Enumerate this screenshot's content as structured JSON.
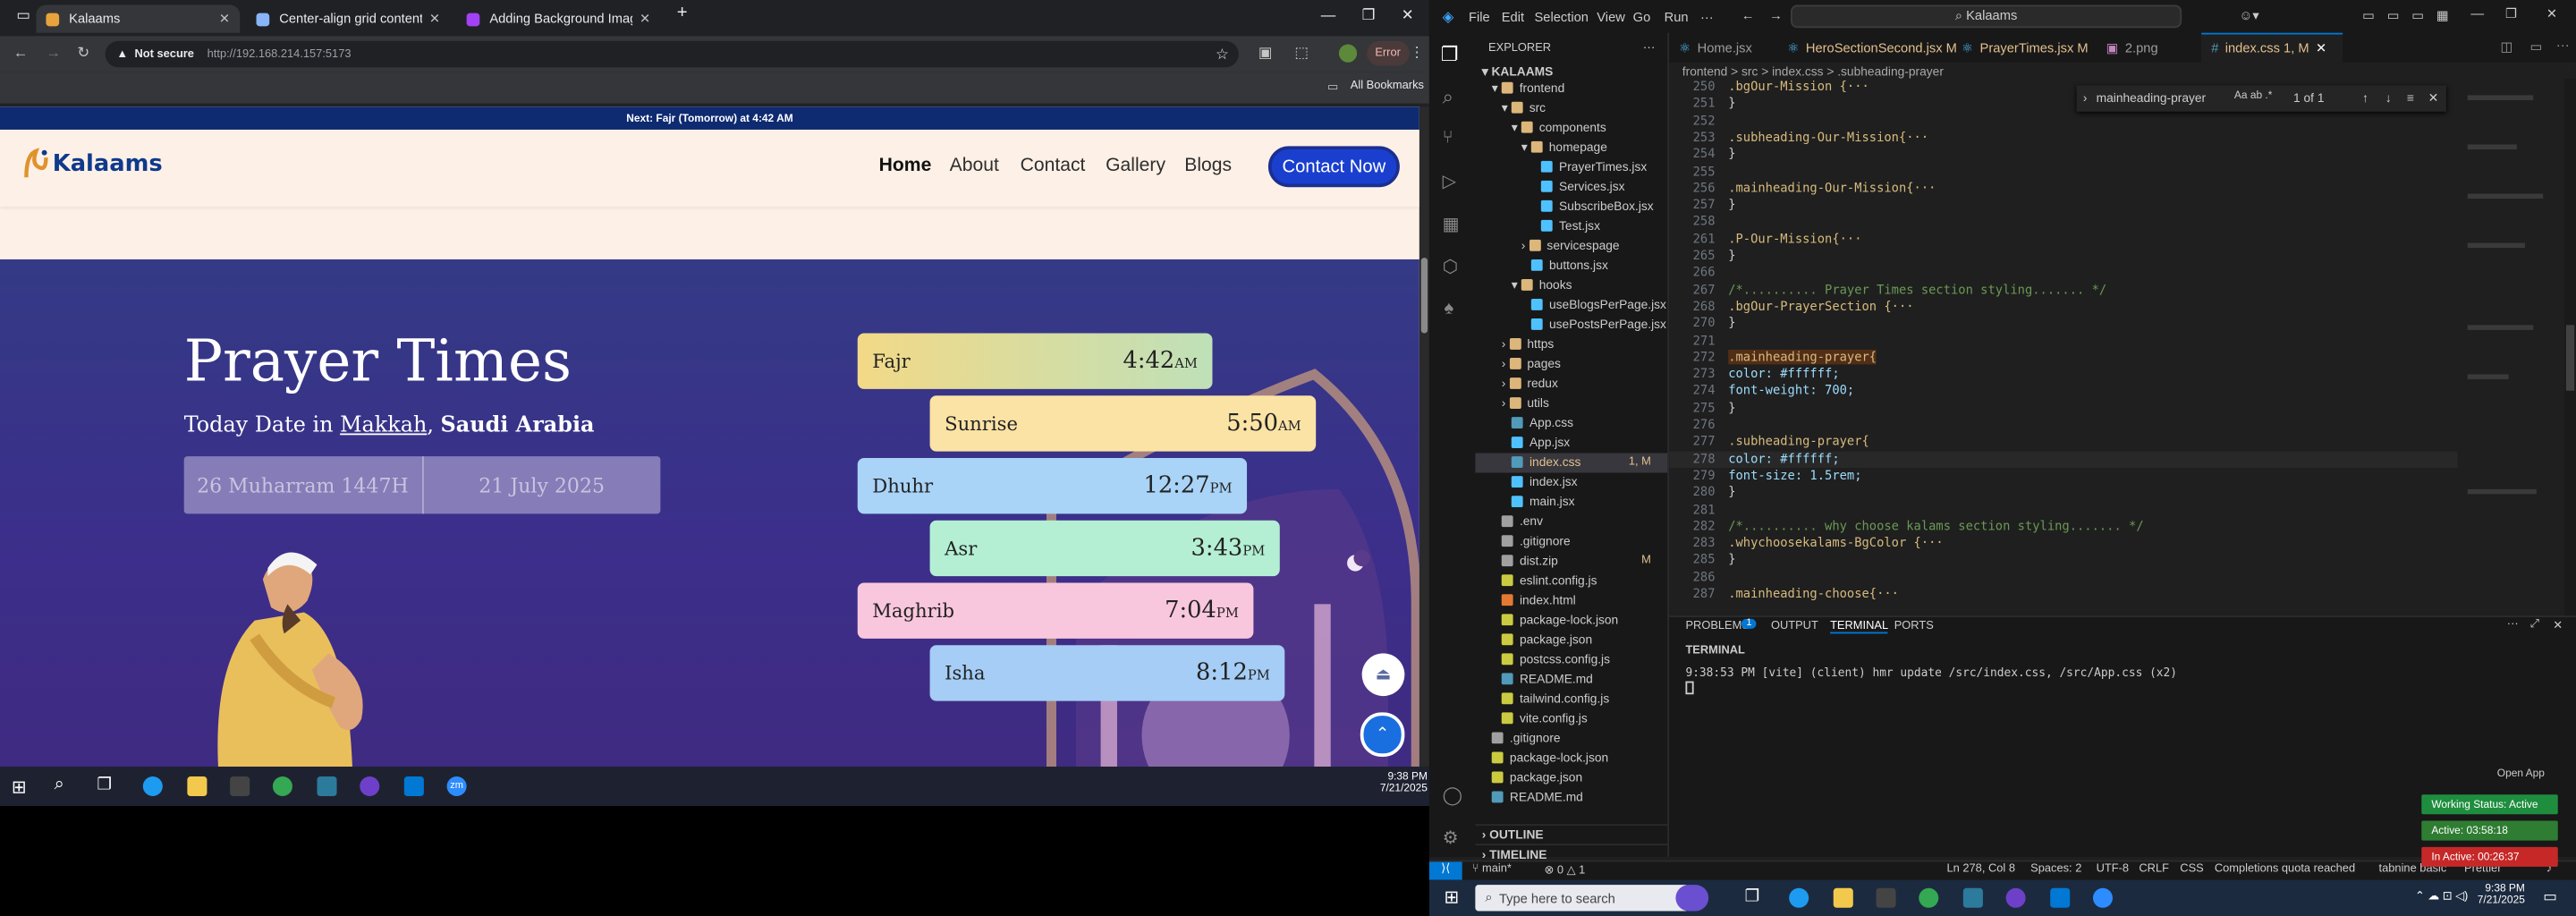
{
  "browser": {
    "tabs": [
      {
        "label": "Kalaams"
      },
      {
        "label": "Center-align grid content"
      },
      {
        "label": "Adding Background Image to F"
      }
    ],
    "new_tab": "+",
    "not_secure": "Not secure",
    "url": "http://192.168.214.157:5173",
    "error_label": "Error",
    "all_bookmarks": "All Bookmarks"
  },
  "site": {
    "top_notice": "Next: Fajr (Tomorrow) at 4:42 AM",
    "logo_text": "Kalaams",
    "nav": [
      "Home",
      "About",
      "Contact",
      "Gallery",
      "Blogs"
    ],
    "contact_button": "Contact Now",
    "hero_title": "Prayer Times",
    "date_line_prefix": "Today Date in",
    "date_city": "Makkah",
    "date_country": "Saudi Arabia",
    "hijri_date": "26 Muharram 1447H",
    "greg_date": "21 July 2025",
    "prayers": [
      {
        "name": "Fajr",
        "time": "4:42",
        "ampm": "AM",
        "color": "#f2d987"
      },
      {
        "name": "Sunrise",
        "time": "5:50",
        "ampm": "AM",
        "color": "#fbe3a6"
      },
      {
        "name": "Dhuhr",
        "time": "12:27",
        "ampm": "PM",
        "color": "#a9d4f7"
      },
      {
        "name": "Asr",
        "time": "3:43",
        "ampm": "PM",
        "color": "#b4efd3"
      },
      {
        "name": "Maghrib",
        "time": "7:04",
        "ampm": "PM",
        "color": "#f9c7dd"
      },
      {
        "name": "Isha",
        "time": "8:12",
        "ampm": "PM",
        "color": "#a5cdf5"
      }
    ]
  },
  "left_taskbar": {
    "time": "9:38 PM",
    "date": "7/21/2025",
    "zoom_label": "zm"
  },
  "vscode": {
    "menu": [
      "File",
      "Edit",
      "Selection",
      "View",
      "Go",
      "Run",
      "···"
    ],
    "search": "Kalaams",
    "explorer_title": "EXPLORER",
    "workspace": "KALAAMS",
    "tree": [
      {
        "label": "frontend",
        "type": "folder"
      },
      {
        "label": "src",
        "type": "folder"
      },
      {
        "label": "components",
        "type": "folder"
      },
      {
        "label": "homepage",
        "type": "folder"
      },
      {
        "label": "PrayerTimes.jsx",
        "type": "jsx"
      },
      {
        "label": "Services.jsx",
        "type": "jsx"
      },
      {
        "label": "SubscribeBox.jsx",
        "type": "jsx"
      },
      {
        "label": "Test.jsx",
        "type": "jsx"
      },
      {
        "label": "servicespage",
        "type": "folder"
      },
      {
        "label": "buttons.jsx",
        "type": "jsx"
      },
      {
        "label": "hooks",
        "type": "folder"
      },
      {
        "label": "useBlogsPerPage.jsx",
        "type": "jsx"
      },
      {
        "label": "usePostsPerPage.jsx",
        "type": "jsx"
      },
      {
        "label": "https",
        "type": "folder"
      },
      {
        "label": "pages",
        "type": "folder"
      },
      {
        "label": "redux",
        "type": "folder"
      },
      {
        "label": "utils",
        "type": "folder"
      },
      {
        "label": "App.css",
        "type": "css"
      },
      {
        "label": "App.jsx",
        "type": "jsx"
      },
      {
        "label": "index.css",
        "type": "css"
      },
      {
        "label": "index.jsx",
        "type": "jsx"
      },
      {
        "label": "main.jsx",
        "type": "jsx"
      },
      {
        "label": ".env",
        "type": "file"
      },
      {
        "label": ".gitignore",
        "type": "file"
      },
      {
        "label": "dist.zip",
        "type": "zip"
      },
      {
        "label": "eslint.config.js",
        "type": "js"
      },
      {
        "label": "index.html",
        "type": "html"
      },
      {
        "label": "package-lock.json",
        "type": "json"
      },
      {
        "label": "package.json",
        "type": "json"
      },
      {
        "label": "postcss.config.js",
        "type": "js"
      },
      {
        "label": "README.md",
        "type": "md"
      },
      {
        "label": "tailwind.config.js",
        "type": "js"
      },
      {
        "label": "vite.config.js",
        "type": "js"
      },
      {
        "label": ".gitignore",
        "type": "file"
      },
      {
        "label": "package-lock.json",
        "type": "json"
      },
      {
        "label": "package.json",
        "type": "json"
      },
      {
        "label": "README.md",
        "type": "md"
      }
    ],
    "markers": {
      "index.css": "1, M",
      "dist.zip": "M"
    },
    "outline": "OUTLINE",
    "timeline": "TIMELINE",
    "tabs": [
      "Home.jsx",
      "HeroSectionSecond.jsx M",
      "PrayerTimes.jsx M",
      "2.png",
      "index.css 1, M"
    ],
    "breadcrumb": "frontend > src > index.css > .subheading-prayer",
    "find_query": "mainheading-prayer",
    "find_result": "1 of 1",
    "code": [
      {
        "n": "250",
        "t": ".bgOur-Mission {···",
        "k": "sel"
      },
      {
        "n": "251",
        "t": "}",
        "k": ""
      },
      {
        "n": "252",
        "t": "",
        "k": ""
      },
      {
        "n": "253",
        "t": ".subheading-Our-Mission{···",
        "k": "sel"
      },
      {
        "n": "254",
        "t": "}",
        "k": ""
      },
      {
        "n": "255",
        "t": "",
        "k": ""
      },
      {
        "n": "256",
        "t": ".mainheading-Our-Mission{···",
        "k": "sel"
      },
      {
        "n": "257",
        "t": "}",
        "k": ""
      },
      {
        "n": "258",
        "t": "",
        "k": ""
      },
      {
        "n": "261",
        "t": ".P-Our-Mission{···",
        "k": "sel"
      },
      {
        "n": "265",
        "t": "}",
        "k": ""
      },
      {
        "n": "266",
        "t": "",
        "k": ""
      },
      {
        "n": "267",
        "t": "/*.......... Prayer Times section styling....... */",
        "k": "cm"
      },
      {
        "n": "268",
        "t": ".bgOur-PrayerSection {···",
        "k": "sel"
      },
      {
        "n": "270",
        "t": "}",
        "k": ""
      },
      {
        "n": "271",
        "t": "",
        "k": ""
      },
      {
        "n": "272",
        "t": ".mainheading-prayer{",
        "k": "sel"
      },
      {
        "n": "273",
        "t": "  color: #ffffff;",
        "k": "prop"
      },
      {
        "n": "274",
        "t": "  font-weight: 700;",
        "k": "prop"
      },
      {
        "n": "275",
        "t": "}",
        "k": ""
      },
      {
        "n": "276",
        "t": "",
        "k": ""
      },
      {
        "n": "277",
        "t": ".subheading-prayer{",
        "k": "sel"
      },
      {
        "n": "278",
        "t": "  color: #ffffff;",
        "k": "prop"
      },
      {
        "n": "279",
        "t": "  font-size: 1.5rem;",
        "k": "prop"
      },
      {
        "n": "280",
        "t": "}",
        "k": ""
      },
      {
        "n": "281",
        "t": "",
        "k": ""
      },
      {
        "n": "282",
        "t": "/*.......... why choose kalams section styling....... */",
        "k": "cm"
      },
      {
        "n": "283",
        "t": ".whychoosekalams-BgColor {···",
        "k": "sel"
      },
      {
        "n": "285",
        "t": "}",
        "k": ""
      },
      {
        "n": "286",
        "t": "",
        "k": ""
      },
      {
        "n": "287",
        "t": ".mainheading-choose{···",
        "k": "sel"
      }
    ],
    "panel_tabs": [
      "PROBLEMS",
      "OUTPUT",
      "TERMINAL",
      "PORTS"
    ],
    "problems_count": "1",
    "terminal_title": "TERMINAL",
    "terminal_line": "9:38:53 PM [vite] (client) hmr update /src/index.css, /src/App.css (x2)",
    "status": {
      "branch": "main*",
      "errors": "0",
      "warnings": "1",
      "position": "Ln 278, Col 8",
      "spaces": "Spaces: 2",
      "encoding": "UTF-8",
      "eol": "CRLF",
      "lang": "CSS",
      "completions": "Completions quota reached",
      "tabnine": "tabnine basic",
      "prettier": "Prettier"
    }
  },
  "windows_taskbar": {
    "search_placeholder": "Type here to search",
    "time": "9:38 PM",
    "date": "7/21/2025"
  },
  "overlay": {
    "open_app": "Open App",
    "working_status": "Working Status: Active",
    "active": "Active: 03:58:18",
    "inactive": "In Active: 00:26:37"
  }
}
